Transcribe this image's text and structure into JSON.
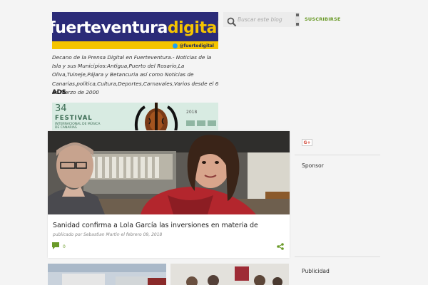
{
  "header": {
    "logo": {
      "word1": "fuerteventura",
      "word2": "digital",
      "handle": "@fuertedigital"
    },
    "description": "Decano de la Prensa Digital en Fuerteventura.- Noticias de la Isla y sus Municipios:Antigua,Puerto del Rosario,La Oliva,Tuineje,Pájara y Betancuria así como Noticias de Canarias,política,Cultura,Deportes,Carnavales,Varios desde el 6 de Marzo de 2000"
  },
  "search": {
    "placeholder": "Buscar este blog"
  },
  "subscribe_label": "SUSCRIBIRSE",
  "ads": {
    "heading": "ADS",
    "banner": {
      "number": "34",
      "festival": "FESTIVAL",
      "subtitle": "INTERNACIONAL DE MÚSICA DE CANARIAS",
      "year": "2018"
    }
  },
  "post": {
    "title": "Sanidad confirma a Lola García las inversiones en materia de",
    "byline": "publicado por Sebastian Martin el febrero 09, 2018",
    "comment_count": "0"
  },
  "sidebar": {
    "gplus_label": "G+",
    "sponsor_heading": "Sponsor",
    "publicidad_heading": "Publicidad"
  },
  "colors": {
    "accent_green": "#6a9a28",
    "logo_navy": "#2b2b78",
    "logo_yellow": "#f5c400"
  }
}
